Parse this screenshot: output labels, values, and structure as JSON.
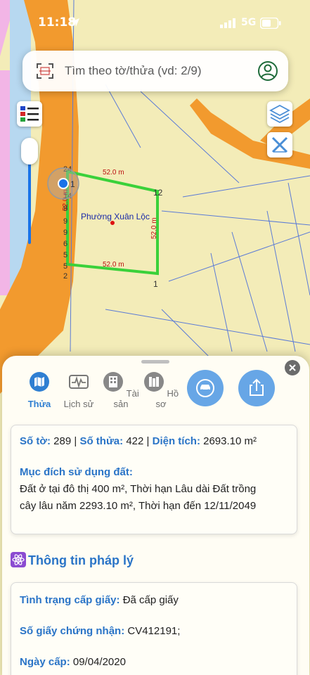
{
  "status_bar": {
    "time": "11:18",
    "network": "5G"
  },
  "search": {
    "placeholder": "Tìm theo tờ/thửa (vd: 2/9)"
  },
  "map": {
    "ward_label": "Phường Xuân Lộc",
    "edge_top": "52.0 m",
    "edge_bottom": "52.0 m",
    "edge_right": "52.0 m",
    "edge_left": "52.0 m",
    "parcel_num_a": "1",
    "parcel_num_b": "12",
    "parcel_num_c": "1",
    "road_labels": [
      "24",
      "14",
      "9",
      "9",
      "9",
      "6",
      "5",
      "5",
      "2"
    ],
    "parcel_color": "#3ad13a",
    "road_color": "#f29a2e"
  },
  "sheet": {
    "tabs": [
      {
        "label": "Thửa",
        "icon": "map-icon"
      },
      {
        "label": "Lịch sử",
        "icon": "history-icon"
      },
      {
        "label": "Tài sản",
        "icon": "building-icon"
      },
      {
        "label": "Hồ sơ",
        "icon": "documents-icon"
      }
    ],
    "info": {
      "so_to_label": "Số tờ:",
      "so_to": "289",
      "so_thua_label": "Số thửa:",
      "so_thua": "422",
      "dien_tich_label": "Diện tích:",
      "dien_tich": "2693.10 m²",
      "muc_dich_label": "Mục đích sử dụng đất:",
      "muc_dich_line1": "Đất ở tại đô thị 400 m², Thời hạn Lâu dài Đất trồng",
      "muc_dich_line2": "cây lâu năm 2293.10 m², Thời hạn đến 12/11/2049"
    },
    "legal_title": "Thông tin pháp lý",
    "legal": {
      "tinh_trang_label": "Tình trạng cấp giấy:",
      "tinh_trang": "Đã cấp giấy",
      "so_giay_label": "Số giấy chứng nhận:",
      "so_giay": "CV412191;",
      "ngay_cap_label": "Ngày cấp:",
      "ngay_cap": "09/04/2020"
    }
  }
}
